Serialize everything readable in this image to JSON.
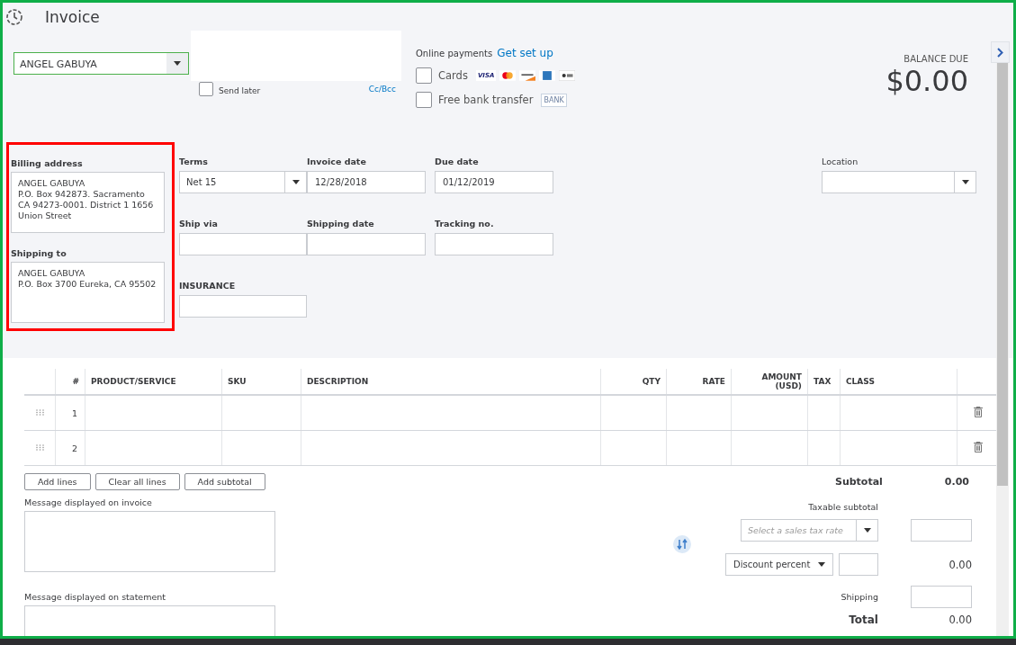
{
  "header": {
    "title": "Invoice"
  },
  "customer": {
    "value": "ANGEL GABUYA"
  },
  "email": {
    "send_later": {
      "label": "Send later",
      "checked": false
    },
    "cc_bcc": "Cc/Bcc"
  },
  "online_payments": {
    "label": "Online payments",
    "link": "Get set up",
    "options": [
      {
        "kind": "cards",
        "label": "Cards",
        "checked": false,
        "badge": "VISA"
      },
      {
        "kind": "bank",
        "label": "Free bank transfer",
        "checked": false,
        "badge": "BANK"
      }
    ]
  },
  "balance": {
    "label": "BALANCE DUE",
    "amount": "$0.00"
  },
  "billing": {
    "label": "Billing address",
    "lines": [
      "ANGEL GABUYA",
      "P.O. Box 942873. Sacramento",
      "CA 94273-0001. District 1 1656",
      "Union Street"
    ]
  },
  "shipping_to": {
    "label": "Shipping to",
    "lines": [
      "ANGEL GABUYA",
      "P.O. Box 3700 Eureka, CA 95502"
    ]
  },
  "fields": [
    {
      "label": "Terms",
      "value": "Net 15",
      "kind": "select"
    },
    {
      "label": "Invoice date",
      "value": "12/28/2018",
      "kind": "text"
    },
    {
      "label": "Due date",
      "value": "01/12/2019",
      "kind": "text"
    },
    {
      "label": "Ship via",
      "kind": "text"
    },
    {
      "label": "Shipping date",
      "kind": "text"
    },
    {
      "label": "Tracking no.",
      "kind": "text"
    },
    {
      "label": "INSURANCE",
      "kind": "text"
    }
  ],
  "location": {
    "label": "Location",
    "kind": "select"
  },
  "table": {
    "columns": [
      "#",
      "PRODUCT/SERVICE",
      "SKU",
      "DESCRIPTION",
      "QTY",
      "RATE",
      "AMOUNT (USD)",
      "TAX",
      "CLASS"
    ],
    "rows": [
      {
        "number": "1"
      },
      {
        "number": "2"
      }
    ]
  },
  "buttons": [
    "Add lines",
    "Clear all lines",
    "Add subtotal"
  ],
  "messages": [
    "Message displayed on invoice",
    "Message displayed on statement"
  ],
  "totals": {
    "subtotal_label": "Subtotal",
    "subtotal": "0.00",
    "taxable_label": "Taxable subtotal",
    "tax_rate_placeholder": "Select a sales tax rate",
    "discount_type": "Discount percent",
    "discount": "0.00",
    "shipping_label": "Shipping",
    "total_label": "Total",
    "total": "0.00"
  }
}
